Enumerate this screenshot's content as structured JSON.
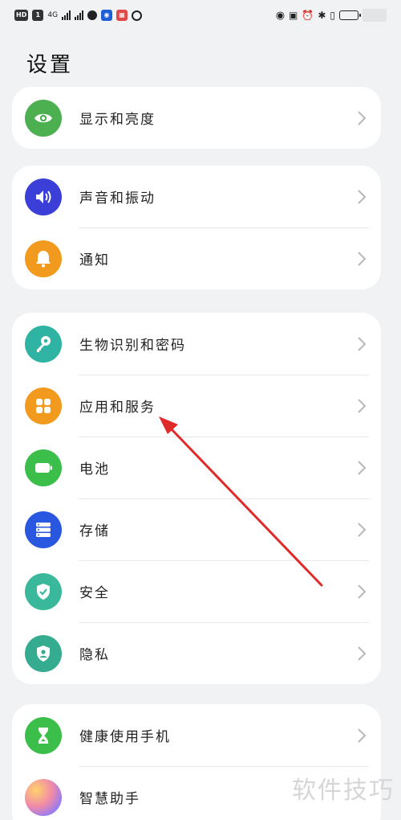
{
  "status_bar": {
    "left_chips": [
      "HD",
      "1",
      "4G",
      "",
      "",
      "",
      ""
    ],
    "network_text": "4G"
  },
  "page": {
    "title": "设置"
  },
  "groups": [
    {
      "items": [
        {
          "label": "显示和亮度",
          "icon": "eye-icon",
          "color": "#4caf50"
        }
      ]
    },
    {
      "items": [
        {
          "label": "声音和振动",
          "icon": "speaker-icon",
          "color": "#3b3fd8"
        },
        {
          "label": "通知",
          "icon": "bell-icon",
          "color": "#f29a1e"
        }
      ]
    },
    {
      "items": [
        {
          "label": "生物识别和密码",
          "icon": "key-icon",
          "color": "#2fb3a3"
        },
        {
          "label": "应用和服务",
          "icon": "apps-grid-icon",
          "color": "#f29a1e"
        },
        {
          "label": "电池",
          "icon": "battery-icon",
          "color": "#3cbf4a"
        },
        {
          "label": "存储",
          "icon": "storage-icon",
          "color": "#2a57e0"
        },
        {
          "label": "安全",
          "icon": "shield-check-icon",
          "color": "#39b89b"
        },
        {
          "label": "隐私",
          "icon": "privacy-shield-icon",
          "color": "#35ab8f"
        }
      ]
    },
    {
      "items": [
        {
          "label": "健康使用手机",
          "icon": "hourglass-icon",
          "color": "#3cbf4a"
        },
        {
          "label": "智慧助手",
          "icon": "assistant-orb-icon",
          "color": "#c66fd6"
        }
      ]
    }
  ],
  "watermark": "软件技巧",
  "annotation": {
    "arrow_color": "#e02b2b"
  }
}
